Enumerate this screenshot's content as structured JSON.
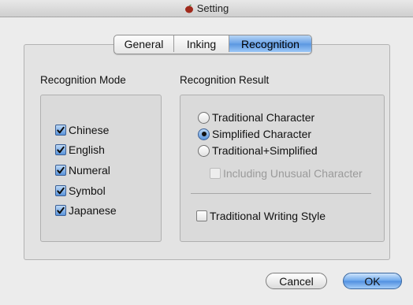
{
  "window": {
    "title": "Setting"
  },
  "tabs": [
    {
      "label": "General",
      "selected": false
    },
    {
      "label": "Inking",
      "selected": false
    },
    {
      "label": "Recognition",
      "selected": true
    }
  ],
  "recognition_mode": {
    "label": "Recognition Mode",
    "items": [
      {
        "label": "Chinese",
        "checked": true
      },
      {
        "label": "English",
        "checked": true
      },
      {
        "label": "Numeral",
        "checked": true
      },
      {
        "label": "Symbol",
        "checked": true
      },
      {
        "label": "Japanese",
        "checked": true
      }
    ]
  },
  "recognition_result": {
    "label": "Recognition Result",
    "options": [
      {
        "label": "Traditional Character",
        "selected": false
      },
      {
        "label": "Simplified Character",
        "selected": true
      },
      {
        "label": "Traditional+Simplified",
        "selected": false
      }
    ],
    "unusual": {
      "label": "Including Unusual Character",
      "checked": false,
      "enabled": false
    },
    "writing_style": {
      "label": "Traditional Writing Style",
      "checked": false
    }
  },
  "buttons": {
    "cancel": "Cancel",
    "ok": "OK"
  },
  "colors": {
    "accent": "#5a96e0",
    "background": "#ececec"
  },
  "icons": {
    "title": "app-icon",
    "check": "checkmark-icon"
  }
}
